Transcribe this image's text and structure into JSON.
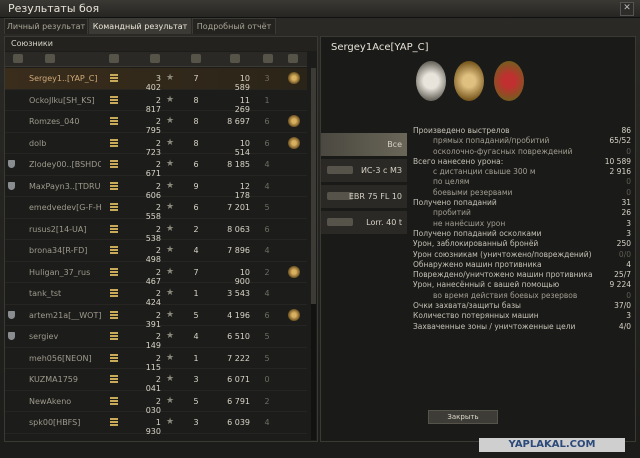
{
  "window": {
    "title": "Результаты боя"
  },
  "tabs": [
    {
      "label": "Личный результат"
    },
    {
      "label": "Командный результат"
    },
    {
      "label": "Подробный отчёт"
    }
  ],
  "allies": {
    "header": "Союзники",
    "rows": [
      {
        "name": "Sergey1..[YAP_C]",
        "damage": "3 402",
        "frags": "7",
        "xp": "10 589",
        "kills": "3",
        "selected": true
      },
      {
        "name": "OckoJlku[SH_KS]",
        "damage": "2 817",
        "frags": "8",
        "xp": "11 269",
        "kills": "1",
        "selected": false
      },
      {
        "name": "Romzes_040",
        "damage": "2 795",
        "frags": "8",
        "xp": "8 697",
        "kills": "6",
        "selected": false
      },
      {
        "name": "dolb",
        "damage": "2 723",
        "frags": "8",
        "xp": "10 514",
        "kills": "6",
        "selected": false
      },
      {
        "name": "Zlodey00..[BSHDO]",
        "damage": "2 671",
        "frags": "6",
        "xp": "8 185",
        "kills": "4",
        "selected": false
      },
      {
        "name": "MaxPayn3..[TDRU]",
        "damage": "2 606",
        "frags": "9",
        "xp": "12 178",
        "kills": "4",
        "selected": false
      },
      {
        "name": "emedvedev[G-F-H]",
        "damage": "2 558",
        "frags": "6",
        "xp": "7 201",
        "kills": "5",
        "selected": false
      },
      {
        "name": "rusus2[14-UA]",
        "damage": "2 538",
        "frags": "2",
        "xp": "8 063",
        "kills": "6",
        "selected": false
      },
      {
        "name": "brona34[R-FD]",
        "damage": "2 498",
        "frags": "4",
        "xp": "7 896",
        "kills": "4",
        "selected": false
      },
      {
        "name": "Huligan_37_rus",
        "damage": "2 467",
        "frags": "7",
        "xp": "10 900",
        "kills": "2",
        "selected": false
      },
      {
        "name": "tank_tst",
        "damage": "2 424",
        "frags": "1",
        "xp": "3 543",
        "kills": "4",
        "selected": false
      },
      {
        "name": "artem21a[__WOT]",
        "damage": "2 391",
        "frags": "5",
        "xp": "4 196",
        "kills": "6",
        "selected": false
      },
      {
        "name": "sergiev",
        "damage": "2 149",
        "frags": "4",
        "xp": "6 510",
        "kills": "5",
        "selected": false
      },
      {
        "name": "meh056[NEON]",
        "damage": "2 115",
        "frags": "1",
        "xp": "7 222",
        "kills": "5",
        "selected": false
      },
      {
        "name": "KUZMA1759",
        "damage": "2 041",
        "frags": "3",
        "xp": "6 071",
        "kills": "0",
        "selected": false
      },
      {
        "name": "NewAkeno",
        "damage": "2 030",
        "frags": "5",
        "xp": "6 791",
        "kills": "2",
        "selected": false
      },
      {
        "name": "spk00[HBFS]",
        "damage": "1 930",
        "frags": "3",
        "xp": "6 039",
        "kills": "4",
        "selected": false
      }
    ]
  },
  "player": {
    "name": "Sergey1Ace[YAP_C]"
  },
  "vehicle_tabs": [
    {
      "label": "Все"
    },
    {
      "label": "ИС-3 с МЗ"
    },
    {
      "label": "EBR 75 FL 10"
    },
    {
      "label": "Lorr. 40 t"
    }
  ],
  "stats": [
    {
      "label": "Произведено выстрелов",
      "value": "86",
      "sub": false,
      "dim": false
    },
    {
      "label": "прямых попаданий/пробитий",
      "value": "65/52",
      "sub": true,
      "dim": false
    },
    {
      "label": "осколочно-фугасных повреждений",
      "value": "0",
      "sub": true,
      "dim": true
    },
    {
      "label": "Всего нанесено урона:",
      "value": "10 589",
      "sub": false,
      "dim": false
    },
    {
      "label": "с дистанции свыше 300 м",
      "value": "2 916",
      "sub": true,
      "dim": false
    },
    {
      "label": "по целям",
      "value": "0",
      "sub": true,
      "dim": true
    },
    {
      "label": "боевыми резервами",
      "value": "0",
      "sub": true,
      "dim": true
    },
    {
      "label": "Получено попаданий",
      "value": "31",
      "sub": false,
      "dim": false
    },
    {
      "label": "пробитий",
      "value": "26",
      "sub": true,
      "dim": false
    },
    {
      "label": "не нанёсших урон",
      "value": "3",
      "sub": true,
      "dim": false
    },
    {
      "label": "Получено попаданий осколками",
      "value": "3",
      "sub": false,
      "dim": false
    },
    {
      "label": "Урон, заблокированный бронёй",
      "value": "250",
      "sub": false,
      "dim": false
    },
    {
      "label": "Урон союзникам (уничтожено/повреждений)",
      "value": "0/0",
      "sub": false,
      "dim": true
    },
    {
      "label": "Обнаружено машин противника",
      "value": "4",
      "sub": false,
      "dim": false
    },
    {
      "label": "Повреждено/уничтожено машин противника",
      "value": "25/7",
      "sub": false,
      "dim": false
    },
    {
      "label": "Урон, нанесённый с вашей помощью",
      "value": "9 224",
      "sub": false,
      "dim": false
    },
    {
      "label": "во время действия боевых резервов",
      "value": "0",
      "sub": true,
      "dim": true
    },
    {
      "label": "Очки захвата/защиты базы",
      "value": "37/0",
      "sub": false,
      "dim": false
    },
    {
      "label": "Количество потерянных машин",
      "value": "3",
      "sub": false,
      "dim": false
    },
    {
      "label": "Захваченные зоны / уничтоженные цели",
      "value": "4/0",
      "sub": false,
      "dim": false
    }
  ],
  "close_label": "Закрыть",
  "watermark": "YAPLAKAL.COM",
  "colors": {
    "accent": "#cfa978",
    "panel": "#1c1c1a"
  }
}
